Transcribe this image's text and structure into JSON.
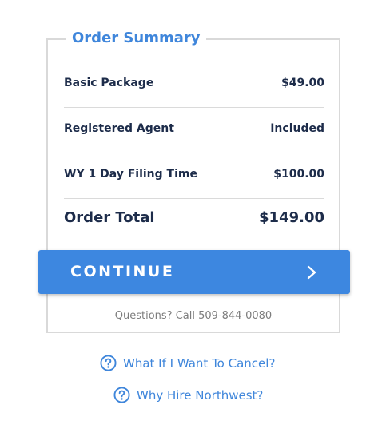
{
  "order_summary": {
    "title": "Order Summary",
    "items": [
      {
        "label": "Basic Package",
        "value": "$49.00"
      },
      {
        "label": "Registered Agent",
        "value": "Included"
      },
      {
        "label": "WY 1 Day Filing Time",
        "value": "$100.00"
      }
    ],
    "total_label": "Order Total",
    "total_value": "$149.00"
  },
  "continue_button": {
    "label": "CONTINUE",
    "icon": "chevron-right-icon"
  },
  "questions_text": "Questions? Call 509-844-0080",
  "help_links": [
    {
      "label": "What If I Want To Cancel?",
      "icon": "question-circle-icon"
    },
    {
      "label": "Why Hire Northwest?",
      "icon": "question-circle-icon"
    }
  ],
  "colors": {
    "accent": "#3f86db",
    "button": "#3d87e0",
    "text_dark": "#1d2c4a",
    "text_muted": "#7d7d7d",
    "border": "#d9d9d9"
  }
}
